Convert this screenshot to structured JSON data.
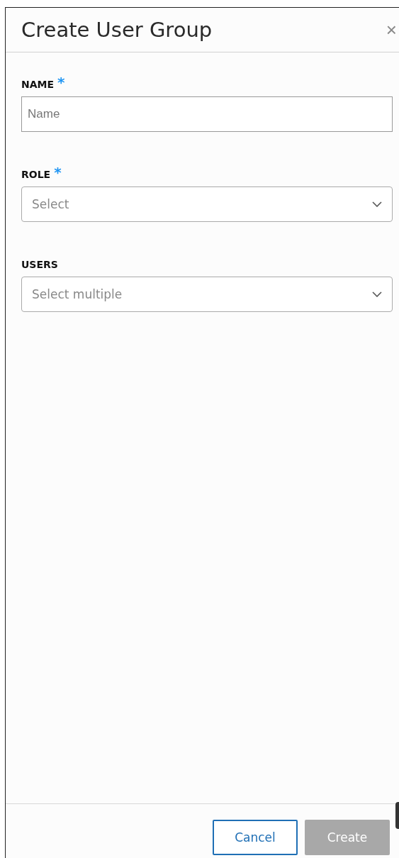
{
  "panel": {
    "title": "Create User Group",
    "close": "×"
  },
  "fields": [
    {
      "kind": "text",
      "label": "NAME",
      "required_mark": "*",
      "placeholder": "Name"
    },
    {
      "kind": "select",
      "label": "ROLE",
      "required_mark": "*",
      "placeholder": "Select"
    },
    {
      "kind": "select",
      "label": "USERS",
      "placeholder": "Select multiple"
    }
  ],
  "buttons": [
    {
      "kind": "secondary",
      "label": "Cancel",
      "disabled": false
    },
    {
      "kind": "primary",
      "label": "Create",
      "disabled": true
    }
  ]
}
